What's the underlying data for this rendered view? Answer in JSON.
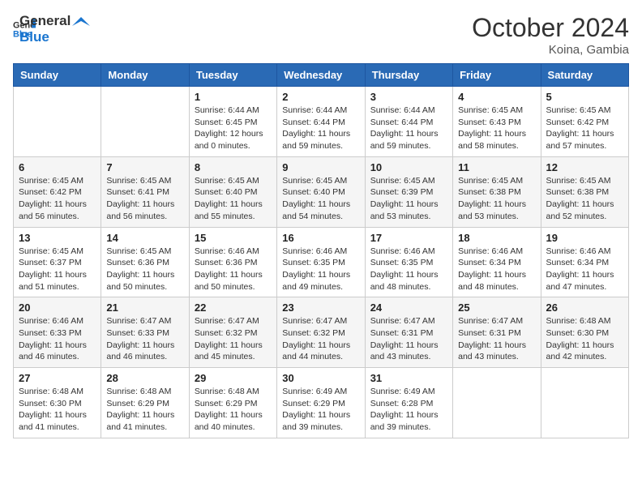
{
  "logo": {
    "line1": "General",
    "line2": "Blue"
  },
  "header": {
    "month_year": "October 2024",
    "location": "Koina, Gambia"
  },
  "days_of_week": [
    "Sunday",
    "Monday",
    "Tuesday",
    "Wednesday",
    "Thursday",
    "Friday",
    "Saturday"
  ],
  "weeks": [
    [
      {
        "day": null,
        "info": ""
      },
      {
        "day": null,
        "info": ""
      },
      {
        "day": "1",
        "info": "Sunrise: 6:44 AM\nSunset: 6:45 PM\nDaylight: 12 hours and 0 minutes."
      },
      {
        "day": "2",
        "info": "Sunrise: 6:44 AM\nSunset: 6:44 PM\nDaylight: 11 hours and 59 minutes."
      },
      {
        "day": "3",
        "info": "Sunrise: 6:44 AM\nSunset: 6:44 PM\nDaylight: 11 hours and 59 minutes."
      },
      {
        "day": "4",
        "info": "Sunrise: 6:45 AM\nSunset: 6:43 PM\nDaylight: 11 hours and 58 minutes."
      },
      {
        "day": "5",
        "info": "Sunrise: 6:45 AM\nSunset: 6:42 PM\nDaylight: 11 hours and 57 minutes."
      }
    ],
    [
      {
        "day": "6",
        "info": "Sunrise: 6:45 AM\nSunset: 6:42 PM\nDaylight: 11 hours and 56 minutes."
      },
      {
        "day": "7",
        "info": "Sunrise: 6:45 AM\nSunset: 6:41 PM\nDaylight: 11 hours and 56 minutes."
      },
      {
        "day": "8",
        "info": "Sunrise: 6:45 AM\nSunset: 6:40 PM\nDaylight: 11 hours and 55 minutes."
      },
      {
        "day": "9",
        "info": "Sunrise: 6:45 AM\nSunset: 6:40 PM\nDaylight: 11 hours and 54 minutes."
      },
      {
        "day": "10",
        "info": "Sunrise: 6:45 AM\nSunset: 6:39 PM\nDaylight: 11 hours and 53 minutes."
      },
      {
        "day": "11",
        "info": "Sunrise: 6:45 AM\nSunset: 6:38 PM\nDaylight: 11 hours and 53 minutes."
      },
      {
        "day": "12",
        "info": "Sunrise: 6:45 AM\nSunset: 6:38 PM\nDaylight: 11 hours and 52 minutes."
      }
    ],
    [
      {
        "day": "13",
        "info": "Sunrise: 6:45 AM\nSunset: 6:37 PM\nDaylight: 11 hours and 51 minutes."
      },
      {
        "day": "14",
        "info": "Sunrise: 6:45 AM\nSunset: 6:36 PM\nDaylight: 11 hours and 50 minutes."
      },
      {
        "day": "15",
        "info": "Sunrise: 6:46 AM\nSunset: 6:36 PM\nDaylight: 11 hours and 50 minutes."
      },
      {
        "day": "16",
        "info": "Sunrise: 6:46 AM\nSunset: 6:35 PM\nDaylight: 11 hours and 49 minutes."
      },
      {
        "day": "17",
        "info": "Sunrise: 6:46 AM\nSunset: 6:35 PM\nDaylight: 11 hours and 48 minutes."
      },
      {
        "day": "18",
        "info": "Sunrise: 6:46 AM\nSunset: 6:34 PM\nDaylight: 11 hours and 48 minutes."
      },
      {
        "day": "19",
        "info": "Sunrise: 6:46 AM\nSunset: 6:34 PM\nDaylight: 11 hours and 47 minutes."
      }
    ],
    [
      {
        "day": "20",
        "info": "Sunrise: 6:46 AM\nSunset: 6:33 PM\nDaylight: 11 hours and 46 minutes."
      },
      {
        "day": "21",
        "info": "Sunrise: 6:47 AM\nSunset: 6:33 PM\nDaylight: 11 hours and 46 minutes."
      },
      {
        "day": "22",
        "info": "Sunrise: 6:47 AM\nSunset: 6:32 PM\nDaylight: 11 hours and 45 minutes."
      },
      {
        "day": "23",
        "info": "Sunrise: 6:47 AM\nSunset: 6:32 PM\nDaylight: 11 hours and 44 minutes."
      },
      {
        "day": "24",
        "info": "Sunrise: 6:47 AM\nSunset: 6:31 PM\nDaylight: 11 hours and 43 minutes."
      },
      {
        "day": "25",
        "info": "Sunrise: 6:47 AM\nSunset: 6:31 PM\nDaylight: 11 hours and 43 minutes."
      },
      {
        "day": "26",
        "info": "Sunrise: 6:48 AM\nSunset: 6:30 PM\nDaylight: 11 hours and 42 minutes."
      }
    ],
    [
      {
        "day": "27",
        "info": "Sunrise: 6:48 AM\nSunset: 6:30 PM\nDaylight: 11 hours and 41 minutes."
      },
      {
        "day": "28",
        "info": "Sunrise: 6:48 AM\nSunset: 6:29 PM\nDaylight: 11 hours and 41 minutes."
      },
      {
        "day": "29",
        "info": "Sunrise: 6:48 AM\nSunset: 6:29 PM\nDaylight: 11 hours and 40 minutes."
      },
      {
        "day": "30",
        "info": "Sunrise: 6:49 AM\nSunset: 6:29 PM\nDaylight: 11 hours and 39 minutes."
      },
      {
        "day": "31",
        "info": "Sunrise: 6:49 AM\nSunset: 6:28 PM\nDaylight: 11 hours and 39 minutes."
      },
      {
        "day": null,
        "info": ""
      },
      {
        "day": null,
        "info": ""
      }
    ]
  ]
}
